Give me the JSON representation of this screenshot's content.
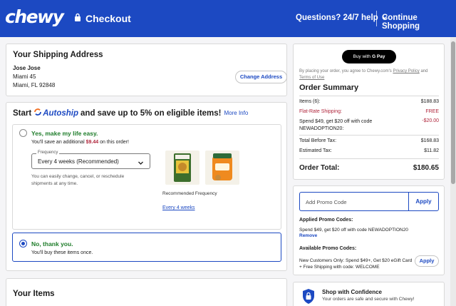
{
  "header": {
    "logo": "chewy",
    "checkout": "Checkout",
    "questions": "Questions? 24/7 help",
    "continue_shopping": "Continue Shopping",
    "bg_color": "#1c49c2"
  },
  "shipping": {
    "title": "Your Shipping Address",
    "name": "Jose Jose",
    "line1": "Miami 45",
    "line2": "Miami, FL 92848",
    "change_button": "Change Address"
  },
  "autoship": {
    "start": "Start",
    "brand": "Autoship",
    "headline_rest": "and save up to 5% on eligible items!",
    "more_info": "More Info",
    "option_yes": {
      "title": "Yes, make my life easy.",
      "save_prefix": "You'll save an additional",
      "save_amount": "$9.44",
      "save_suffix": "on this order!",
      "frequency_label": "Frequency",
      "frequency_value": "Every 4 weeks (Recommended)",
      "note": "You can easily change, cancel, or reschedule shipments at any time.",
      "recommended_label": "Recommended Frequency",
      "recommended_value": "Every 4 weeks"
    },
    "option_no": {
      "title": "No, thank you.",
      "subtitle": "You'll buy these items once."
    }
  },
  "items": {
    "title": "Your Items"
  },
  "summary": {
    "gpay_label": "Buy with",
    "gpay_brand": "G Pay",
    "agree_text": "By placing your order, you agree to Chewy.com's",
    "privacy": "Privacy Policy",
    "and": "and",
    "terms": "Terms of Use",
    "title": "Order Summary",
    "items_label": "Items (6):",
    "items_value": "$188.83",
    "shipping_label": "Flat-Rate Shipping:",
    "shipping_value": "FREE",
    "promo_label": "Spend $49, get $20 off with code NEWADOPTION20:",
    "promo_value": "-$20.00",
    "before_tax_label": "Total Before Tax:",
    "before_tax_value": "$168.83",
    "tax_label": "Estimated Tax:",
    "tax_value": "$11.82",
    "total_label": "Order Total:",
    "total_value": "$180.65"
  },
  "promo": {
    "placeholder": "Add Promo Code",
    "apply": "Apply",
    "applied_title": "Applied Promo Codes:",
    "applied_text": "Spend $49, get $20 off with code NEWADOPTION20",
    "remove": "Remove",
    "available_title": "Available Promo Codes:",
    "available_text": "New Customers Only: Spend $49+, Get $20 eGift Card + Free Shipping with code: WELCOME",
    "available_apply": "Apply"
  },
  "confidence": {
    "title": "Shop with Confidence",
    "subtitle": "Your orders are safe and secure with Chewy!"
  }
}
